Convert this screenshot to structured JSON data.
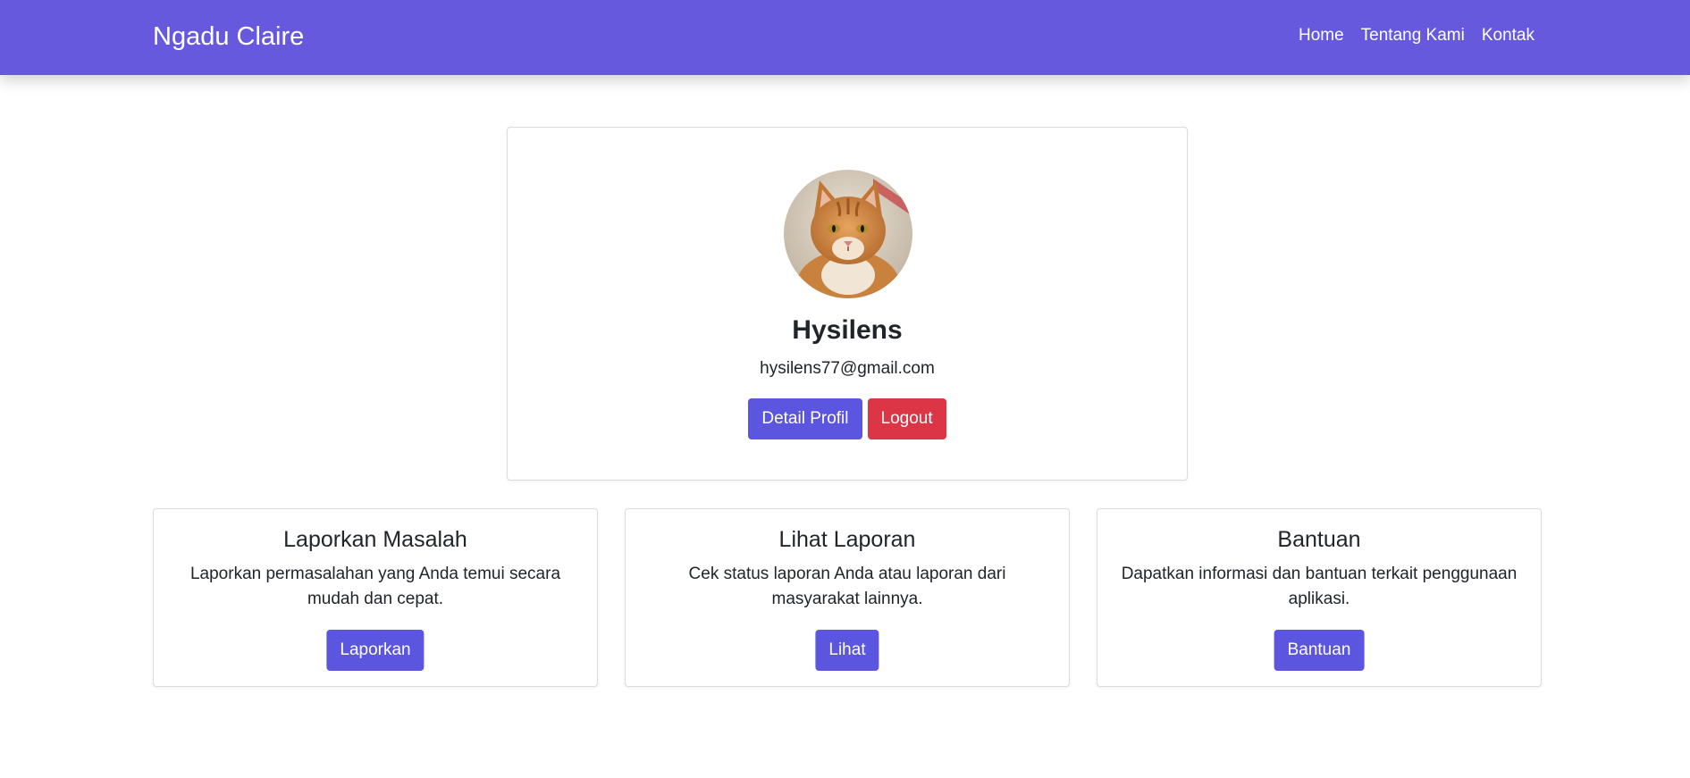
{
  "navbar": {
    "brand": "Ngadu Claire",
    "links": [
      "Home",
      "Tentang Kami",
      "Kontak"
    ],
    "color": "#6659de"
  },
  "profile": {
    "name": "Hysilens",
    "email": "hysilens77@gmail.com",
    "avatar_icon": "cat-avatar",
    "detail_button": "Detail Profil",
    "logout_button": "Logout"
  },
  "cards": [
    {
      "title": "Laporkan Masalah",
      "description": "Laporkan permasalahan yang Anda temui secara mudah dan cepat.",
      "button": "Laporkan"
    },
    {
      "title": "Lihat Laporan",
      "description": "Cek status laporan Anda atau laporan dari masyarakat lainnya.",
      "button": "Lihat"
    },
    {
      "title": "Bantuan",
      "description": "Dapatkan informasi dan bantuan terkait penggunaan aplikasi.",
      "button": "Bantuan"
    }
  ],
  "colors": {
    "primary": "#5b55e0",
    "danger": "#dc3545"
  }
}
